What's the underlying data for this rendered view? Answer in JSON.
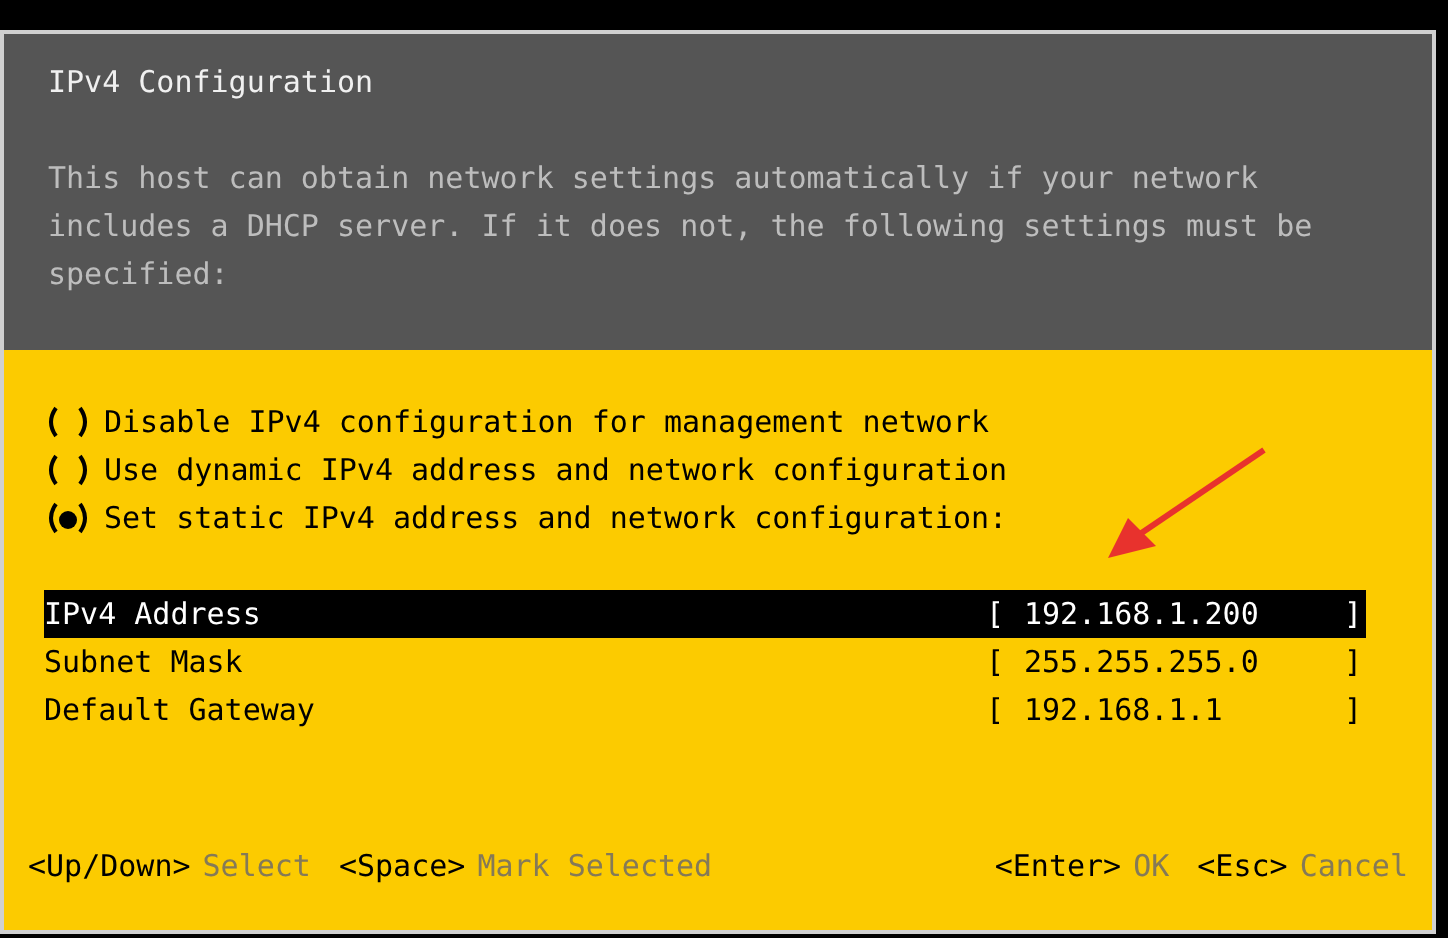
{
  "dialog": {
    "title": "IPv4 Configuration",
    "description": "This host can obtain network settings automatically if your network includes a DHCP server. If it does not, the following settings must be specified:"
  },
  "options": [
    {
      "label": "Disable IPv4 configuration for management network",
      "selected": false
    },
    {
      "label": "Use dynamic IPv4 address and network configuration",
      "selected": false
    },
    {
      "label": "Set static IPv4 address and network configuration:",
      "selected": true
    }
  ],
  "fields": [
    {
      "label": "IPv4 Address",
      "open": "[",
      "value": "192.168.1.200",
      "close": "]",
      "selected": true
    },
    {
      "label": "Subnet Mask",
      "open": "[",
      "value": "255.255.255.0",
      "close": "]",
      "selected": false
    },
    {
      "label": "Default Gateway",
      "open": "[",
      "value": "192.168.1.1",
      "close": "]",
      "selected": false
    }
  ],
  "footer": {
    "left": [
      {
        "key": "<Up/Down>",
        "action": "Select"
      },
      {
        "key": "<Space>",
        "action": "Mark Selected"
      }
    ],
    "right": [
      {
        "key": "<Enter>",
        "action": "OK"
      },
      {
        "key": "<Esc>",
        "action": "Cancel"
      }
    ]
  }
}
